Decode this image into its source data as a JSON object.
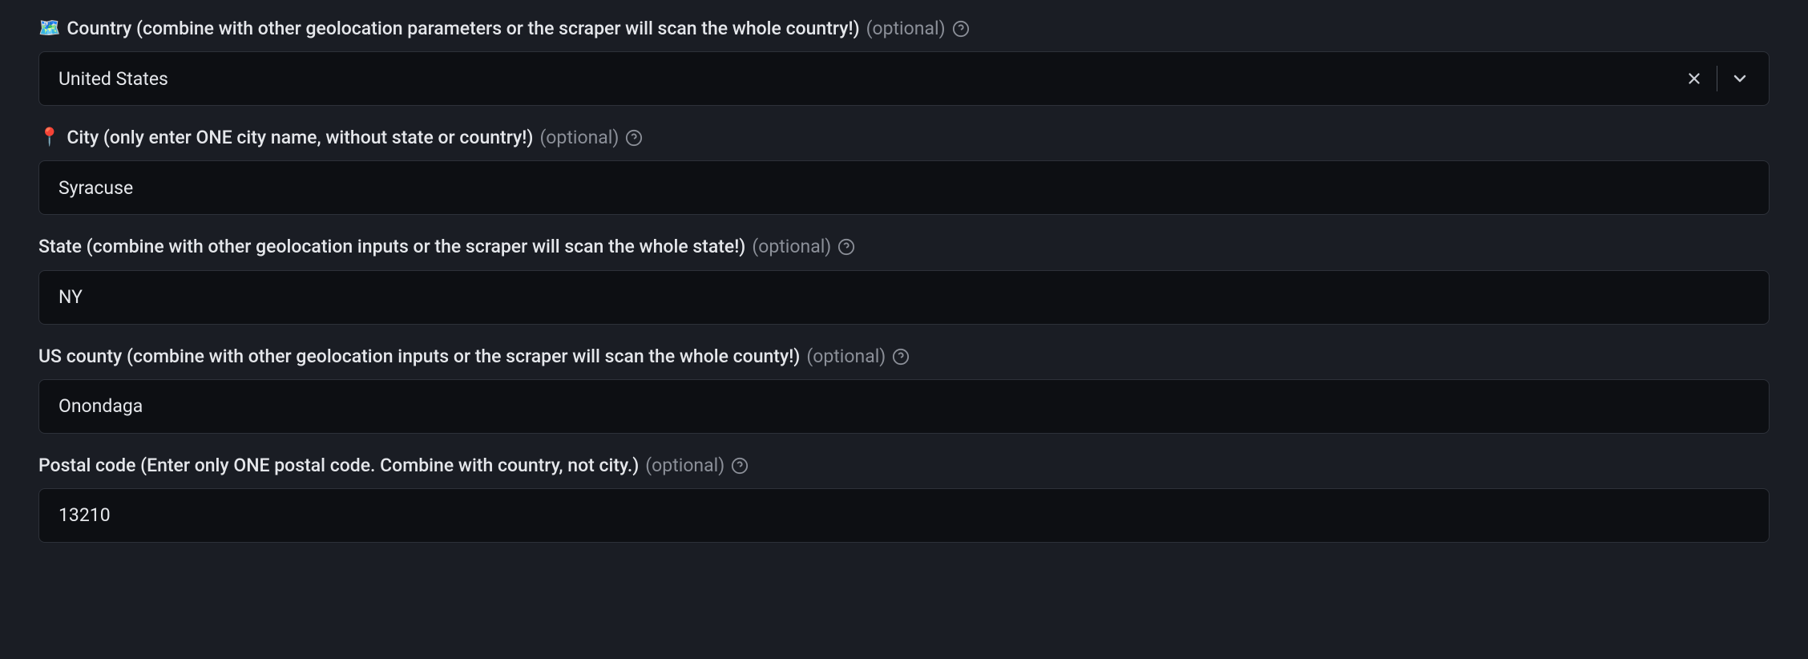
{
  "fields": {
    "country": {
      "emoji": "🗺️",
      "label": "Country (combine with other geolocation parameters or the scraper will scan the whole country!)",
      "optional": "(optional)",
      "value": "United States"
    },
    "city": {
      "emoji": "📍",
      "label": "City (only enter ONE city name, without state or country!)",
      "optional": "(optional)",
      "value": "Syracuse"
    },
    "state": {
      "label": "State (combine with other geolocation inputs or the scraper will scan the whole state!)",
      "optional": "(optional)",
      "value": "NY"
    },
    "county": {
      "label": "US county (combine with other geolocation inputs or the scraper will scan the whole county!)",
      "optional": "(optional)",
      "value": "Onondaga"
    },
    "postal": {
      "label": "Postal code (Enter only ONE postal code. Combine with country, not city.)",
      "optional": "(optional)",
      "value": "13210"
    }
  }
}
